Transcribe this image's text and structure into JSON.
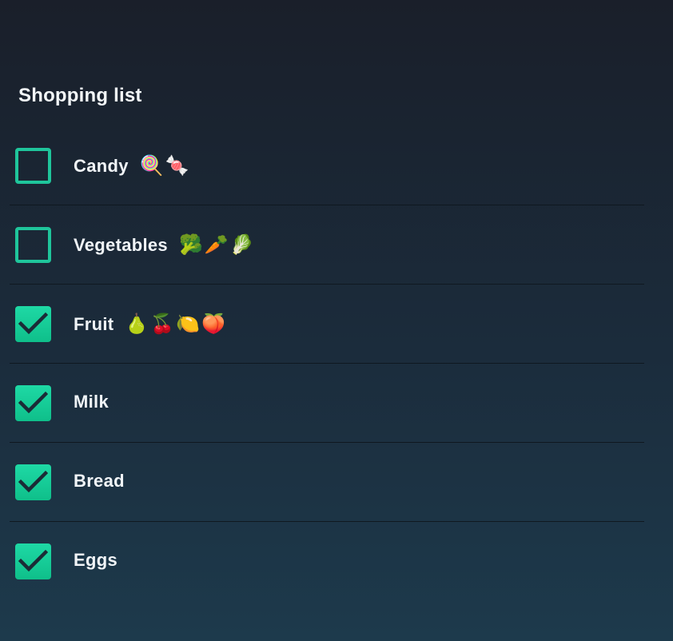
{
  "list": {
    "title": "Shopping list",
    "items": [
      {
        "label": "Candy",
        "emoji": "🍭🍬",
        "checked": false
      },
      {
        "label": "Vegetables",
        "emoji": "🥦🥕🥬",
        "checked": false
      },
      {
        "label": "Fruit",
        "emoji": "🍐🍒🍋🍑",
        "checked": true
      },
      {
        "label": "Milk",
        "emoji": "",
        "checked": true
      },
      {
        "label": "Bread",
        "emoji": "",
        "checked": true
      },
      {
        "label": "Eggs",
        "emoji": "",
        "checked": true
      }
    ]
  },
  "colors": {
    "accent": "#1ed9a5",
    "checkmark": "#1b2b36",
    "text": "#f0f4f7"
  }
}
